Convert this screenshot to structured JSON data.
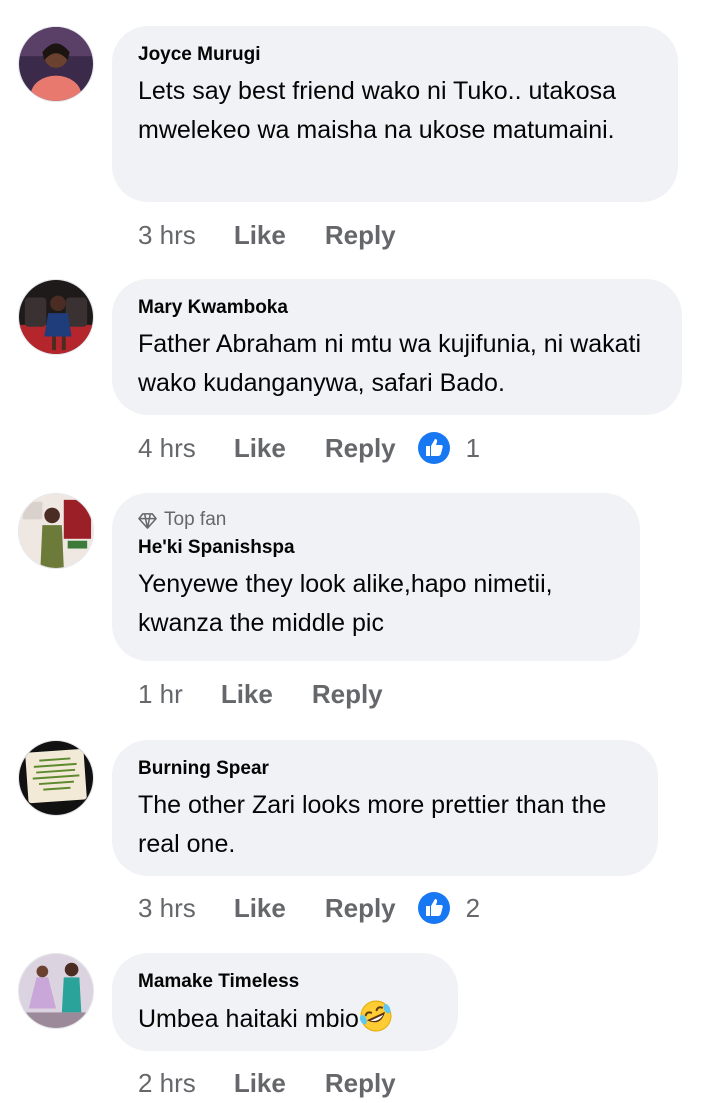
{
  "comments": [
    {
      "author": "Joyce Murugi",
      "text": "Lets say best friend wako ni Tuko.. utakosa mwelekeo wa maisha na ukose matumaini.",
      "time": "3 hrs",
      "like_label": "Like",
      "reply_label": "Reply"
    },
    {
      "author": "Mary Kwamboka",
      "text": "Father Abraham ni mtu wa kujifunia, ni wakati wako kudanganywa, safari Bado.",
      "time": "4 hrs",
      "like_label": "Like",
      "reply_label": "Reply",
      "reactions": "1"
    },
    {
      "badge": "Top fan",
      "author": "He'ki Spanishspa",
      "text": "Yenyewe they look alike,hapo nimetii, kwanza the middle pic",
      "time": "1 hr",
      "like_label": "Like",
      "reply_label": "Reply"
    },
    {
      "author": "Burning Spear",
      "text": "The other Zari looks more prettier than the real one.",
      "time": "3 hrs",
      "like_label": "Like",
      "reply_label": "Reply",
      "reactions": "2"
    },
    {
      "author": "Mamake Timeless",
      "text": "Umbea haitaki mbio",
      "emoji": "rolling-on-floor-laughing-emoji",
      "time": "2 hrs",
      "like_label": "Like",
      "reply_label": "Reply"
    }
  ],
  "colors": {
    "bubble": "#f0f2f5",
    "meta": "#65676b",
    "like_blue": "#1877f2"
  }
}
